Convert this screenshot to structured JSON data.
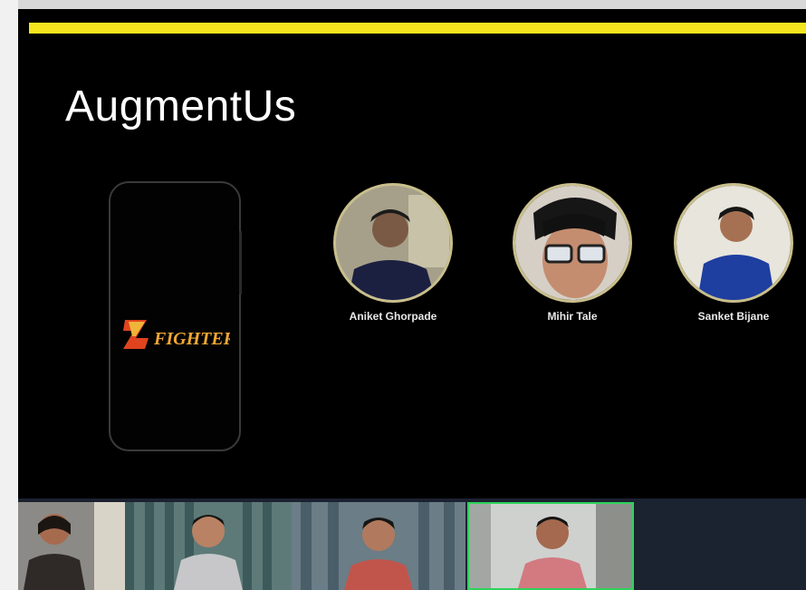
{
  "slide": {
    "title": "AugmentUs",
    "accent_color": "#f4e51e",
    "logo_text": "FIGHTER",
    "logo_mark": "Z",
    "team": [
      {
        "name": "Aniket Ghorpade"
      },
      {
        "name": "Mihir Tale"
      },
      {
        "name": "Sanket Bijane"
      }
    ]
  },
  "gallery": {
    "participants": [
      {
        "label": ""
      },
      {
        "label": ""
      },
      {
        "label": ""
      },
      {
        "label": ""
      }
    ],
    "active_speaker_color": "#2fd25a"
  }
}
